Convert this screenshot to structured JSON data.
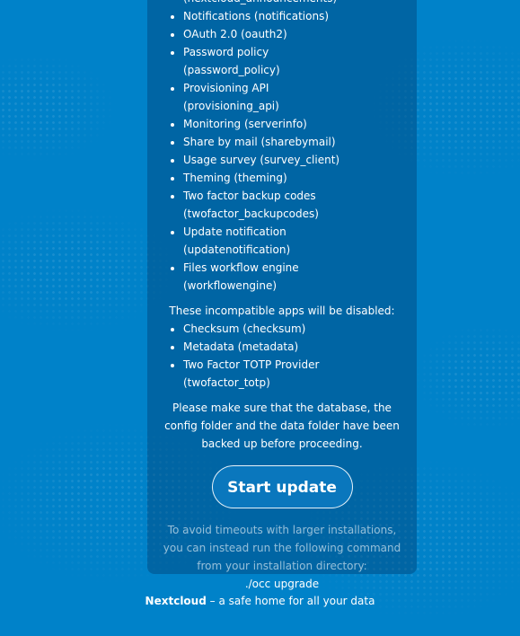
{
  "update": {
    "enabled_apps": [
      "(nextcloud_announcements)",
      "Notifications (notifications)",
      "OAuth 2.0 (oauth2)",
      "Password policy (password_policy)",
      "Provisioning API (provisioning_api)",
      "Monitoring (serverinfo)",
      "Share by mail (sharebymail)",
      "Usage survey (survey_client)",
      "Theming (theming)",
      "Two factor backup codes (twofactor_backupcodes)",
      "Update notification (updatenotification)",
      "Files workflow engine (workflowengine)"
    ],
    "disabled_heading": "These incompatible apps will be disabled:",
    "disabled_apps": [
      "Checksum (checksum)",
      "Metadata (metadata)",
      "Two Factor TOTP Provider (twofactor_totp)"
    ],
    "warning": "Please make sure that the database, the config folder and the data folder have been backed up before proceeding.",
    "start_button": "Start update",
    "timeout_note": "To avoid timeouts with larger installations, you can instead run the following command from your installation directory:",
    "command": "./occ upgrade"
  },
  "footer": {
    "brand": "Nextcloud",
    "tagline": " – a safe home for all your data"
  },
  "colors": {
    "background": "#0082c9",
    "panel": "#0a4f80"
  }
}
